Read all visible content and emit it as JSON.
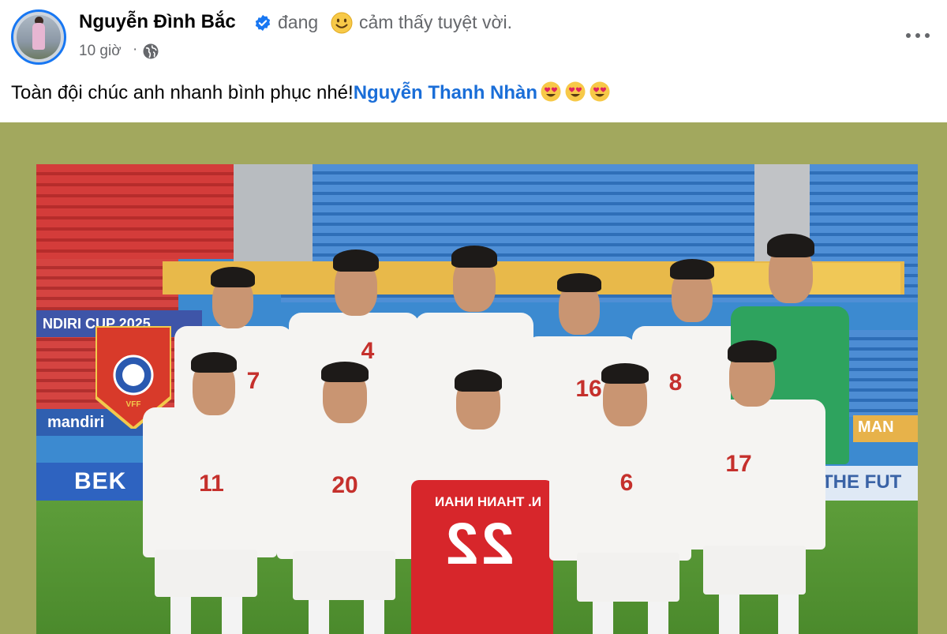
{
  "post": {
    "author": "Nguyễn Đình Bắc",
    "feeling_prefix": "đang",
    "feeling_text": "cảm thấy tuyệt vời.",
    "time": "10 giờ",
    "separator": "·",
    "caption_text": "Toàn đội chúc anh nhanh bình phục nhé!",
    "mention": "Nguyễn Thanh Nhàn",
    "icons": {
      "verified": "verified-badge-icon",
      "feeling": "smiling-face-icon",
      "privacy": "globe-icon",
      "more": "more-options-icon",
      "emoji": "heart-eyes-emoji"
    }
  },
  "photo": {
    "boards": {
      "mandiri": "mandiri",
      "bek": "BEK",
      "future": "THE FUT",
      "man": "MAN",
      "cup": "NDIRI CUP 2025"
    },
    "pennant_text": "VFF",
    "jersey_name": "N. THANH NHAN",
    "jersey_number": "22",
    "back_row_numbers": [
      "7",
      "4",
      "",
      "16",
      "8",
      ""
    ],
    "front_row_numbers": [
      "11",
      "20",
      "",
      "6",
      "17"
    ]
  },
  "colors": {
    "frame": "#a2a85e",
    "mention": "#1a6ed8",
    "secondary_text": "#65676b",
    "accent": "#1877f2"
  }
}
